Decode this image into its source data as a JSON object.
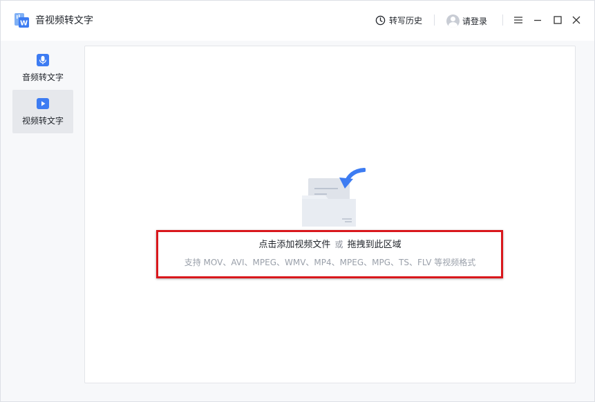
{
  "app": {
    "title": "音视频转文字",
    "logo_icon": "app-logo-icon"
  },
  "header": {
    "history_label": "转写历史",
    "history_icon": "clock-icon",
    "login_label": "请登录",
    "avatar_icon": "avatar-icon",
    "window_controls": [
      "menu-icon",
      "minimize-icon",
      "maximize-icon",
      "close-icon"
    ]
  },
  "sidebar": {
    "items": [
      {
        "label": "音频转文字",
        "icon": "microphone-icon",
        "active": false
      },
      {
        "label": "视频转文字",
        "icon": "video-camera-icon",
        "active": true
      }
    ]
  },
  "upload": {
    "main_text_part1": "点击添加视频文件",
    "or_text": "或",
    "main_text_part2": "拖拽到此区域",
    "formats_text": "支持 MOV、AVI、MPEG、WMV、MP4、MPEG、MPG、TS、FLV 等视频格式"
  },
  "colors": {
    "accent_blue": "#3d7cf2",
    "highlight_red": "#d9171c",
    "background": "#f7f8fa"
  }
}
